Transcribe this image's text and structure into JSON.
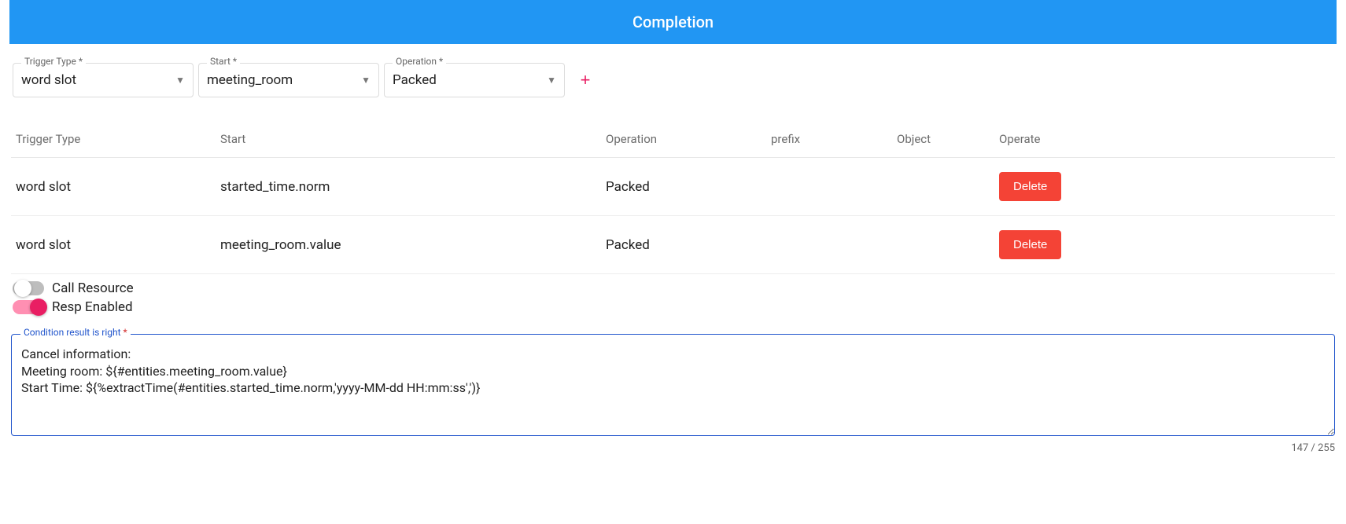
{
  "header": {
    "title": "Completion"
  },
  "filters": {
    "trigger_type": {
      "label": "Trigger Type *",
      "value": "word slot"
    },
    "start": {
      "label": "Start *",
      "value": "meeting_room"
    },
    "operation": {
      "label": "Operation *",
      "value": "Packed"
    }
  },
  "table": {
    "headers": {
      "trigger_type": "Trigger Type",
      "start": "Start",
      "operation": "Operation",
      "prefix": "prefix",
      "object": "Object",
      "operate": "Operate"
    },
    "rows": [
      {
        "trigger_type": "word slot",
        "start": "started_time.norm",
        "operation": "Packed",
        "prefix": "",
        "object": "",
        "delete_label": "Delete"
      },
      {
        "trigger_type": "word slot",
        "start": "meeting_room.value",
        "operation": "Packed",
        "prefix": "",
        "object": "",
        "delete_label": "Delete"
      }
    ]
  },
  "toggles": {
    "call_resource": {
      "label": "Call Resource",
      "on": false
    },
    "resp_enabled": {
      "label": "Resp Enabled",
      "on": true
    }
  },
  "textarea": {
    "label": "Condition result is right ",
    "star": "*",
    "value": "Cancel information:\nMeeting room: ${#entities.meeting_room.value}\nStart Time: ${%extractTime(#entities.started_time.norm,'yyyy-MM-dd HH:mm:ss',')}",
    "counter": "147 / 255"
  }
}
